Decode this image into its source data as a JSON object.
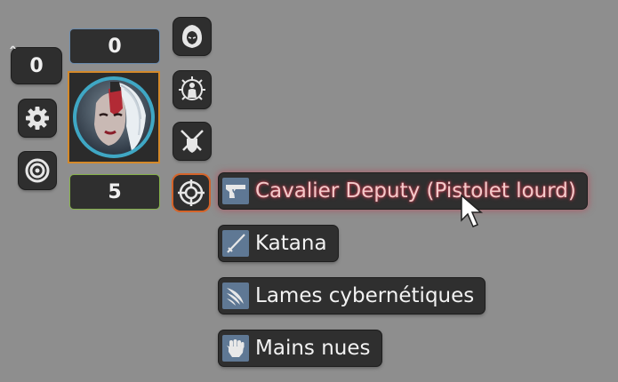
{
  "hud": {
    "level_value": "0",
    "top_counter": "0",
    "bottom_counter": "5"
  },
  "weapons": [
    {
      "label": "Cavalier Deputy (Pistolet lourd)",
      "icon": "pistol-icon",
      "highlighted": true
    },
    {
      "label": "Katana",
      "icon": "katana-icon",
      "highlighted": false
    },
    {
      "label": "Lames cybernétiques",
      "icon": "cyber-blades-icon",
      "highlighted": false
    },
    {
      "label": "Mains nues",
      "icon": "fist-icon",
      "highlighted": false
    }
  ],
  "colors": {
    "background": "#8e8e8e",
    "button": "#2e2e2e",
    "highlight_text": "#f2c9c9",
    "highlight_glow": "#c0394b",
    "portrait_border": "#d4892a",
    "top_counter_border": "#6b8caf",
    "bottom_counter_border": "#86b24a",
    "weapon_icon_bg": "#5f7894"
  }
}
